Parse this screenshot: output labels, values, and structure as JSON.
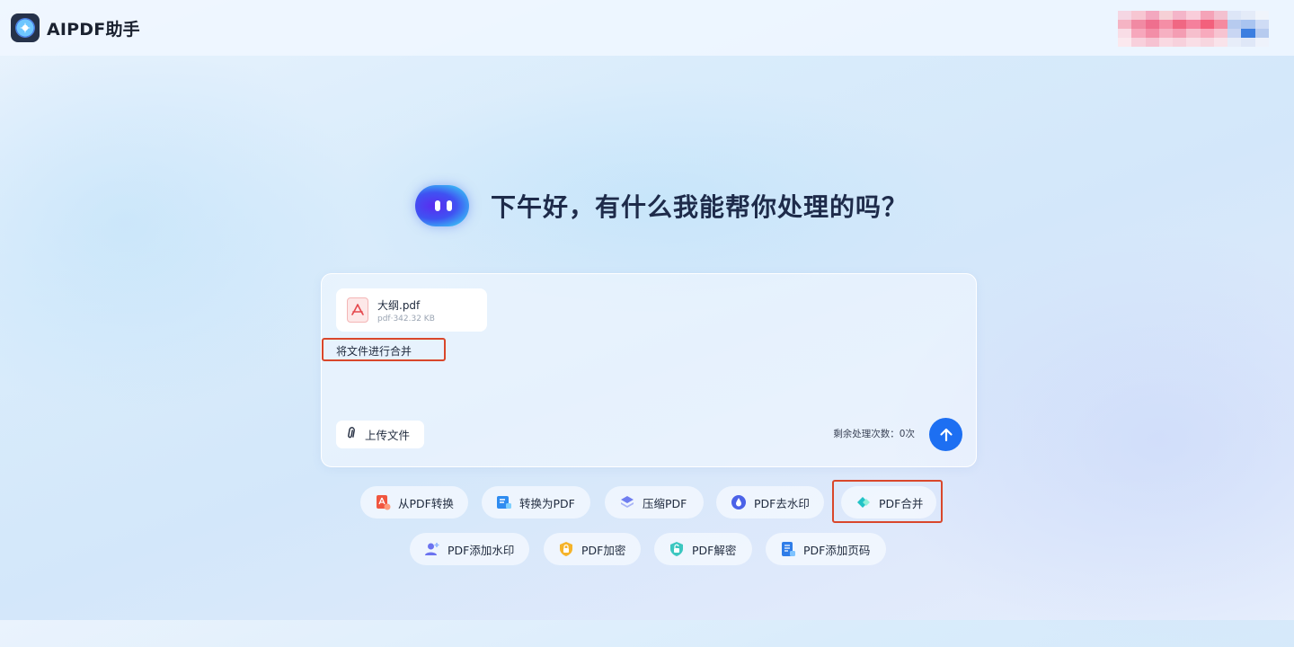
{
  "app": {
    "name": "AIPDF助手",
    "greeting": "下午好，有什么我能帮你处理的吗？"
  },
  "header": {
    "logo_icon": "sparkle-logo-icon",
    "avatar_colors": [
      "#f5d6e3",
      "#f7c6d2",
      "#f3a8bf",
      "#f6d0d6",
      "#f4b5c9",
      "#f9cdda",
      "#f5a3b8",
      "#f3c1d0",
      "#dde6f7",
      "#e4ebf8",
      "#f0f4fb",
      "#f5b4c4",
      "#f18aa3",
      "#ef6f8e",
      "#f58ea6",
      "#f06783",
      "#f5809c",
      "#f3607c",
      "#f58a9f",
      "#b7cbef",
      "#a9c4f0",
      "#cfdcf5",
      "#f9dde6",
      "#f7a7bc",
      "#f38ea7",
      "#f6b0c2",
      "#f49db3",
      "#f6bfcd",
      "#f8aabd",
      "#f7c4d1",
      "#c9d6f3",
      "#3c7ee0",
      "#b7cbef",
      "#fbe8ee",
      "#f8d0dc",
      "#f6c2d1",
      "#f9d9e2",
      "#f7d1dc",
      "#f9dee6",
      "#f7d6df",
      "#f9e3ea",
      "#e7edf9",
      "#dfe7f7",
      "#eef2fb"
    ]
  },
  "composer": {
    "file": {
      "name": "大纲.pdf",
      "info": "pdf·342.32 KB",
      "icon": "pdf-file-icon"
    },
    "prompt_text": "将文件进行合并",
    "upload_label": "上传文件",
    "quota_text": "剩余处理次数：0次",
    "send_icon": "arrow-up-icon",
    "accent": "#1d6ff2"
  },
  "tools": [
    {
      "label": "从PDF转换",
      "icon": "pdf-convert-from-icon",
      "color": "#f0563f"
    },
    {
      "label": "转换为PDF",
      "icon": "convert-to-pdf-icon",
      "color": "#2f8cf0"
    },
    {
      "label": "压缩PDF",
      "icon": "compress-pdf-icon",
      "color": "#6f7ef0"
    },
    {
      "label": "PDF去水印",
      "icon": "remove-watermark-icon",
      "color": "#4b62e8"
    },
    {
      "label": "PDF合并",
      "icon": "merge-pdf-icon",
      "color": "#22c3c6"
    },
    {
      "label": "PDF添加水印",
      "icon": "add-watermark-icon",
      "color": "#6b73f0"
    },
    {
      "label": "PDF加密",
      "icon": "lock-pdf-icon",
      "color": "#f5b32a"
    },
    {
      "label": "PDF解密",
      "icon": "unlock-pdf-icon",
      "color": "#3cc7c0"
    },
    {
      "label": "PDF添加页码",
      "icon": "page-number-icon",
      "color": "#2f7de8"
    }
  ]
}
